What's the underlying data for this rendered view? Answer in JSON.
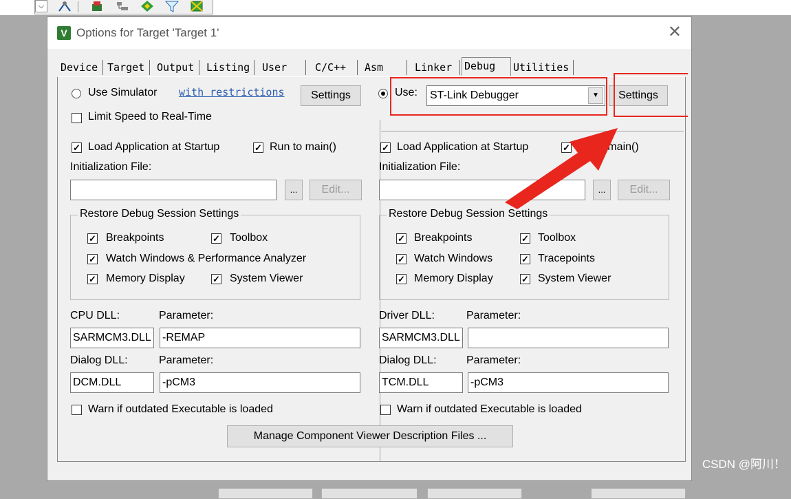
{
  "window": {
    "title": "Options for Target 'Target 1'",
    "icon": "keil-uvision-icon"
  },
  "tabs": [
    {
      "label": "Device"
    },
    {
      "label": "Target"
    },
    {
      "label": "Output"
    },
    {
      "label": "Listing"
    },
    {
      "label": "User"
    },
    {
      "label": "C/C++"
    },
    {
      "label": "Asm"
    },
    {
      "label": "Linker"
    },
    {
      "label": "Debug",
      "active": true
    },
    {
      "label": "Utilities"
    }
  ],
  "left": {
    "use_simulator_label": "Use Simulator",
    "restrictions_link": "with restrictions",
    "settings_label": "Settings",
    "limit_speed_label": "Limit Speed to Real-Time",
    "load_app_label": "Load Application at Startup",
    "run_to_main_label": "Run to main()",
    "init_file_label": "Initialization File:",
    "browse_label": "...",
    "edit_label": "Edit...",
    "restore_group_label": "Restore Debug Session Settings",
    "breakpoints_label": "Breakpoints",
    "toolbox_label": "Toolbox",
    "watch_label": "Watch Windows & Performance Analyzer",
    "memory_label": "Memory Display",
    "system_viewer_label": "System Viewer",
    "cpu_dll_label": "CPU DLL:",
    "cpu_param_label": "Parameter:",
    "cpu_dll_value": "SARMCM3.DLL",
    "cpu_param_value": "-REMAP",
    "dialog_dll_label": "Dialog DLL:",
    "dialog_param_label": "Parameter:",
    "dialog_dll_value": "DCM.DLL",
    "dialog_param_value": "-pCM3",
    "warn_label": "Warn if outdated Executable is loaded"
  },
  "right": {
    "use_label": "Use:",
    "debugger_value": "ST-Link Debugger",
    "settings_label": "Settings",
    "load_app_label": "Load Application at Startup",
    "run_to_main_label": "o main()",
    "init_file_label": "Initialization File:",
    "browse_label": "...",
    "edit_label": "Edit...",
    "restore_group_label": "Restore Debug Session Settings",
    "breakpoints_label": "Breakpoints",
    "toolbox_label": "Toolbox",
    "watch_label": "Watch Windows",
    "tracepoints_label": "Tracepoints",
    "memory_label": "Memory Display",
    "system_viewer_label": "System Viewer",
    "driver_dll_label": "Driver DLL:",
    "driver_param_label": "Parameter:",
    "driver_dll_value": "SARMCM3.DLL",
    "driver_param_value": "",
    "dialog_dll_label": "Dialog DLL:",
    "dialog_param_label": "Parameter:",
    "dialog_dll_value": "TCM.DLL",
    "dialog_param_value": "-pCM3",
    "warn_label": "Warn if outdated Executable is loaded"
  },
  "manage_button_label": "Manage Component Viewer Description Files ...",
  "watermark": "CSDN @阿川！",
  "colors": {
    "highlight": "#e8261e",
    "background": "#a9a9a9",
    "dialog": "#f0f0f0"
  }
}
